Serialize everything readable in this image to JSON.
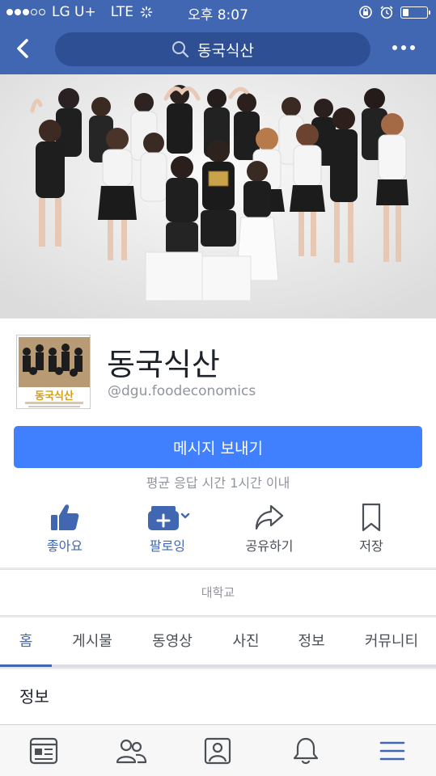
{
  "status_bar": {
    "carrier": "LG U+",
    "network": "LTE",
    "time": "오후 8:07"
  },
  "nav": {
    "search_text": "동국식산"
  },
  "page": {
    "name": "동국식산",
    "handle": "@dgu.foodeconomics",
    "message_button": "메시지 보내기",
    "response_time": "평균 응답 시간 1시간 이내",
    "category": "대학교",
    "avatar_text": "동국식산"
  },
  "actions": [
    {
      "label": "좋아요",
      "icon": "thumbs-up-icon"
    },
    {
      "label": "팔로잉",
      "icon": "following-icon"
    },
    {
      "label": "공유하기",
      "icon": "share-icon"
    },
    {
      "label": "저장",
      "icon": "bookmark-icon"
    }
  ],
  "tabs": [
    {
      "label": "홈",
      "active": true
    },
    {
      "label": "게시물"
    },
    {
      "label": "동영상"
    },
    {
      "label": "사진"
    },
    {
      "label": "정보"
    },
    {
      "label": "커뮤니티"
    }
  ],
  "info_section": {
    "title": "정보"
  },
  "bottom_nav": [
    {
      "icon": "news-feed-icon"
    },
    {
      "icon": "friends-icon"
    },
    {
      "icon": "profile-icon"
    },
    {
      "icon": "notifications-icon"
    },
    {
      "icon": "menu-icon",
      "active": true
    }
  ],
  "colors": {
    "header": "#4267b2",
    "search_bg": "#2f4f95",
    "message_button": "#4080ff",
    "active_blue": "#4267b2"
  }
}
